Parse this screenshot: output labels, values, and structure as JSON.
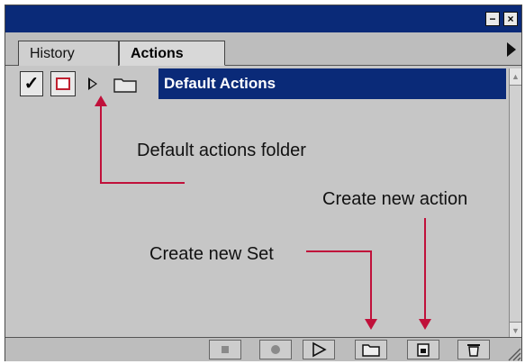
{
  "panel": {
    "title_controls": {
      "minimize_glyph": "−",
      "close_glyph": "×"
    },
    "tabs": [
      {
        "label": "History",
        "active": false
      },
      {
        "label": "Actions",
        "active": true
      }
    ],
    "menu_icon": "triangle-right-icon"
  },
  "actions_list": {
    "toggle_check_glyph": "✓",
    "items": [
      {
        "label": "Default Actions",
        "type": "set",
        "expanded": false,
        "selected": true
      }
    ]
  },
  "annotations": {
    "default_folder": "Default actions folder",
    "new_action": "Create new action",
    "new_set": "Create new Set"
  },
  "toolbar": {
    "buttons": [
      {
        "name": "stop-button",
        "icon": "stop-icon"
      },
      {
        "name": "record-button",
        "icon": "record-icon"
      },
      {
        "name": "play-button",
        "icon": "play-icon"
      },
      {
        "name": "new-set-button",
        "icon": "folder-icon"
      },
      {
        "name": "new-action-button",
        "icon": "new-action-icon"
      },
      {
        "name": "delete-button",
        "icon": "trash-icon"
      }
    ]
  },
  "colors": {
    "title_bar": "#0a2a78",
    "selection": "#0a2a78",
    "panel_bg": "#c6c6c6",
    "arrow": "#c0103a"
  }
}
